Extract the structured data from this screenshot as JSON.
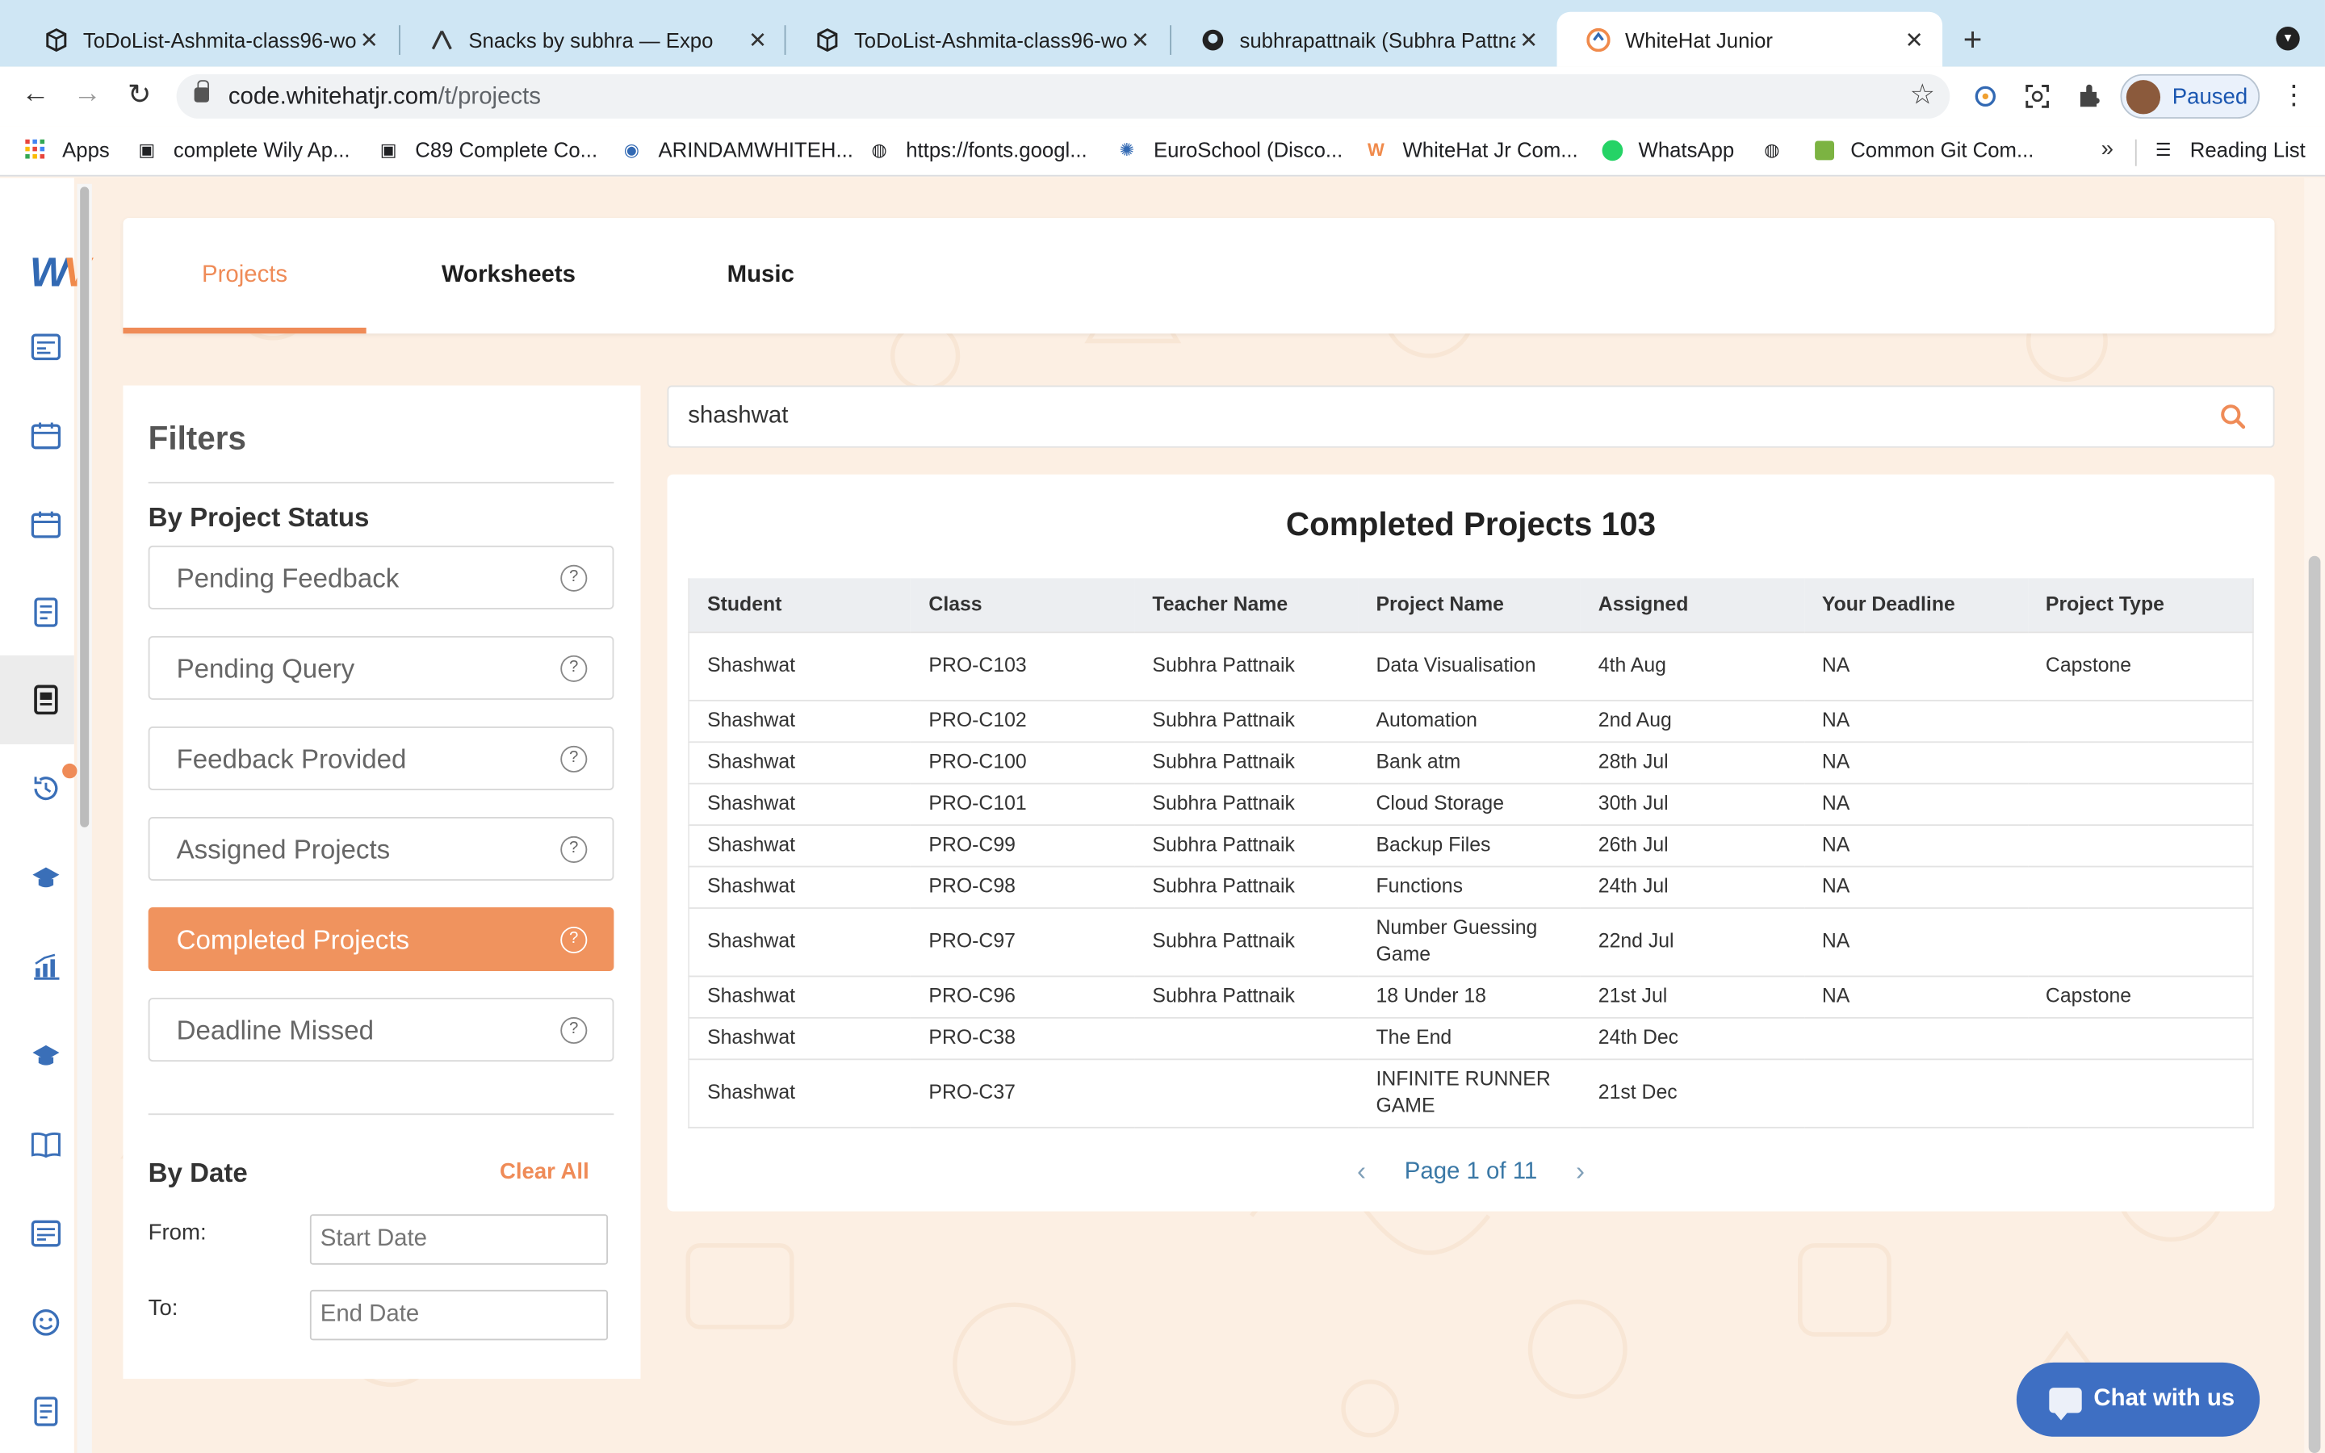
{
  "browser": {
    "tabs": [
      {
        "title": "ToDoList-Ashmita-class96-wo",
        "icon": "cube-icon"
      },
      {
        "title": "Snacks by subhra — Expo",
        "icon": "expo-icon"
      },
      {
        "title": "ToDoList-Ashmita-class96-wo",
        "icon": "cube-icon"
      },
      {
        "title": "subhrapattnaik (Subhra Pattna",
        "icon": "github-icon"
      },
      {
        "title": "WhiteHat Junior",
        "icon": "whitehat-icon"
      }
    ],
    "url_host": "code.whitehatjr.com",
    "url_path": "/t/projects",
    "profile_label": "Paused",
    "bookmarks": [
      "Apps",
      "complete Wily Ap...",
      "C89 Complete Co...",
      "ARINDAMWHITEH...",
      "https://fonts.googl...",
      "EuroSchool (Disco...",
      "WhiteHat Jr Com...",
      "WhatsApp",
      "",
      "Common Git Com..."
    ],
    "more_bookmarks": "»",
    "reading_list": "Reading List"
  },
  "nav_tabs": {
    "projects": "Projects",
    "worksheets": "Worksheets",
    "music": "Music"
  },
  "filters": {
    "title": "Filters",
    "by_status": "By Project Status",
    "statuses": [
      {
        "label": "Pending Feedback",
        "selected": false
      },
      {
        "label": "Pending Query",
        "selected": false
      },
      {
        "label": "Feedback Provided",
        "selected": false
      },
      {
        "label": "Assigned Projects",
        "selected": false
      },
      {
        "label": "Completed Projects",
        "selected": true
      },
      {
        "label": "Deadline Missed",
        "selected": false
      }
    ],
    "help_glyph": "?",
    "by_date": "By Date",
    "clear_all": "Clear All",
    "from_label": "From:",
    "to_label": "To:",
    "start_placeholder": "Start Date",
    "end_placeholder": "End Date"
  },
  "search": {
    "value": "shashwat"
  },
  "results": {
    "title": "Completed Projects 103",
    "columns": [
      "Student",
      "Class",
      "Teacher Name",
      "Project Name",
      "Assigned",
      "Your Deadline",
      "Project Type"
    ],
    "rows": [
      [
        "Shashwat",
        "PRO-C103",
        "Subhra Pattnaik",
        "Data Visualisation",
        "4th Aug",
        "NA",
        "Capstone"
      ],
      [
        "Shashwat",
        "PRO-C102",
        "Subhra Pattnaik",
        "Automation",
        "2nd Aug",
        "NA",
        ""
      ],
      [
        "Shashwat",
        "PRO-C100",
        "Subhra Pattnaik",
        "Bank atm",
        "28th Jul",
        "NA",
        ""
      ],
      [
        "Shashwat",
        "PRO-C101",
        "Subhra Pattnaik",
        "Cloud Storage",
        "30th Jul",
        "NA",
        ""
      ],
      [
        "Shashwat",
        "PRO-C99",
        "Subhra Pattnaik",
        "Backup Files",
        "26th Jul",
        "NA",
        ""
      ],
      [
        "Shashwat",
        "PRO-C98",
        "Subhra Pattnaik",
        "Functions",
        "24th Jul",
        "NA",
        ""
      ],
      [
        "Shashwat",
        "PRO-C97",
        "Subhra Pattnaik",
        "Number Guessing Game",
        "22nd Jul",
        "NA",
        ""
      ],
      [
        "Shashwat",
        "PRO-C96",
        "Subhra Pattnaik",
        "18 Under 18",
        "21st Jul",
        "NA",
        "Capstone"
      ],
      [
        "Shashwat",
        "PRO-C38",
        "",
        "The End",
        "24th Dec",
        "",
        ""
      ],
      [
        "Shashwat",
        "PRO-C37",
        "",
        "INFINITE RUNNER GAME",
        "21st Dec",
        "",
        ""
      ]
    ],
    "pager": "Page 1 of 11"
  },
  "chat_label": "Chat with us",
  "colors": {
    "accent": "#ef8b57",
    "brand_blue": "#3e6fc3",
    "link": "#3a78a6"
  }
}
